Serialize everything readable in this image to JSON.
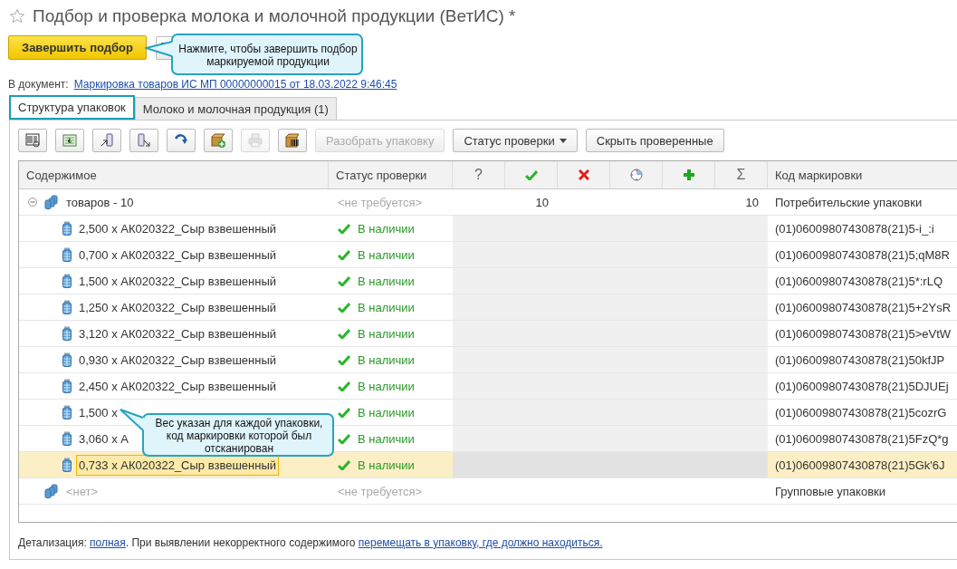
{
  "window": {
    "title": "Подбор и проверка молока и молочной продукции (ВетИС) *"
  },
  "actions": [
    {
      "kind": "primary",
      "label": "Завершить подбор"
    },
    {
      "kind": "icon"
    }
  ],
  "document": {
    "label": "В документ:",
    "link": "Маркировка товаров ИС МП 00000000015 от 18.03.2022 9:46:45"
  },
  "tabs": [
    {
      "label": "Структура упаковок",
      "selected": true
    },
    {
      "label": "Молоко и молочная продукция (1)",
      "selected": false
    }
  ],
  "toolbar": [
    {
      "kind": "icon",
      "disabled": false
    },
    {
      "kind": "icon",
      "disabled": false
    },
    {
      "kind": "icon",
      "disabled": false
    },
    {
      "kind": "icon",
      "disabled": false
    },
    {
      "kind": "icon",
      "disabled": false
    },
    {
      "kind": "icon",
      "disabled": false
    },
    {
      "kind": "icon",
      "disabled": true
    },
    {
      "kind": "icon",
      "disabled": false
    },
    {
      "kind": "text",
      "label": "Разобрать упаковку",
      "disabled": true
    },
    {
      "kind": "dropdown",
      "label": "Статус проверки",
      "disabled": false
    },
    {
      "kind": "text",
      "label": "Скрыть проверенные",
      "disabled": false
    }
  ],
  "table": {
    "columns": [
      {
        "kind": "text",
        "label": "Содержимое"
      },
      {
        "kind": "text",
        "label": "Статус проверки"
      },
      {
        "kind": "text",
        "label": "?"
      },
      {
        "kind": "icon"
      },
      {
        "kind": "icon"
      },
      {
        "kind": "icon"
      },
      {
        "kind": "icon"
      },
      {
        "kind": "text",
        "label": "Σ"
      },
      {
        "kind": "text",
        "label": "Код маркировки"
      }
    ],
    "rows": [
      {
        "kind": "group",
        "expanded": true,
        "content": "товаров - 10",
        "status": {
          "kind": "not_required",
          "text": "<не требуется>"
        },
        "count_ok": "10",
        "count_total": "10",
        "code": "Потребительские упаковки"
      },
      {
        "kind": "item",
        "selected": false,
        "content": "2,500 x АК020322_Сыр взвешенный",
        "status": {
          "kind": "present",
          "text": "В наличии"
        },
        "code": "(01)06009807430878(21)5-i_:i"
      },
      {
        "kind": "item",
        "selected": false,
        "content": "0,700 x АК020322_Сыр взвешенный",
        "status": {
          "kind": "present",
          "text": "В наличии"
        },
        "code": "(01)06009807430878(21)5;qM8R"
      },
      {
        "kind": "item",
        "selected": false,
        "content": "1,500 x АК020322_Сыр взвешенный",
        "status": {
          "kind": "present",
          "text": "В наличии"
        },
        "code": "(01)06009807430878(21)5*:rLQ"
      },
      {
        "kind": "item",
        "selected": false,
        "content": "1,250 x АК020322_Сыр взвешенный",
        "status": {
          "kind": "present",
          "text": "В наличии"
        },
        "code": "(01)06009807430878(21)5+2YsR"
      },
      {
        "kind": "item",
        "selected": false,
        "content": "3,120 x АК020322_Сыр взвешенный",
        "status": {
          "kind": "present",
          "text": "В наличии"
        },
        "code": "(01)06009807430878(21)5>eVtW"
      },
      {
        "kind": "item",
        "selected": false,
        "content": "0,930 x АК020322_Сыр взвешенный",
        "status": {
          "kind": "present",
          "text": "В наличии"
        },
        "code": "(01)06009807430878(21)50kfJP"
      },
      {
        "kind": "item",
        "selected": false,
        "content": "2,450 x АК020322_Сыр взвешенный",
        "status": {
          "kind": "present",
          "text": "В наличии"
        },
        "code": "(01)06009807430878(21)5DJUEj"
      },
      {
        "kind": "item",
        "selected": false,
        "content": "1,500 x",
        "status": {
          "kind": "present",
          "text": "В наличии"
        },
        "code": "(01)06009807430878(21)5cozrG"
      },
      {
        "kind": "item",
        "selected": false,
        "content": "3,060 x А",
        "status": {
          "kind": "present",
          "text": "В наличии"
        },
        "code": "(01)06009807430878(21)5FzQ*g"
      },
      {
        "kind": "item",
        "selected": true,
        "content": "0,733 x АК020322_Сыр взвешенный",
        "status": {
          "kind": "present",
          "text": "В наличии"
        },
        "code": "(01)06009807430878(21)5Gk'6J"
      },
      {
        "kind": "empty_group",
        "content": "<нет>",
        "status": {
          "kind": "not_required",
          "text": "<не требуется>"
        },
        "code": "Групповые упаковки"
      }
    ]
  },
  "footer": {
    "label": "Детализация:",
    "link": "полная",
    "text": ". При выявлении некорректного содержимого",
    "action_link": "перемещать в упаковку, где должно находиться."
  },
  "callouts": [
    {
      "text": "Нажмите, чтобы завершить подбор маркируемой продукции"
    },
    {
      "text": "Вес указан для каждой упаковки, код маркировки которой был отсканирован"
    }
  ]
}
